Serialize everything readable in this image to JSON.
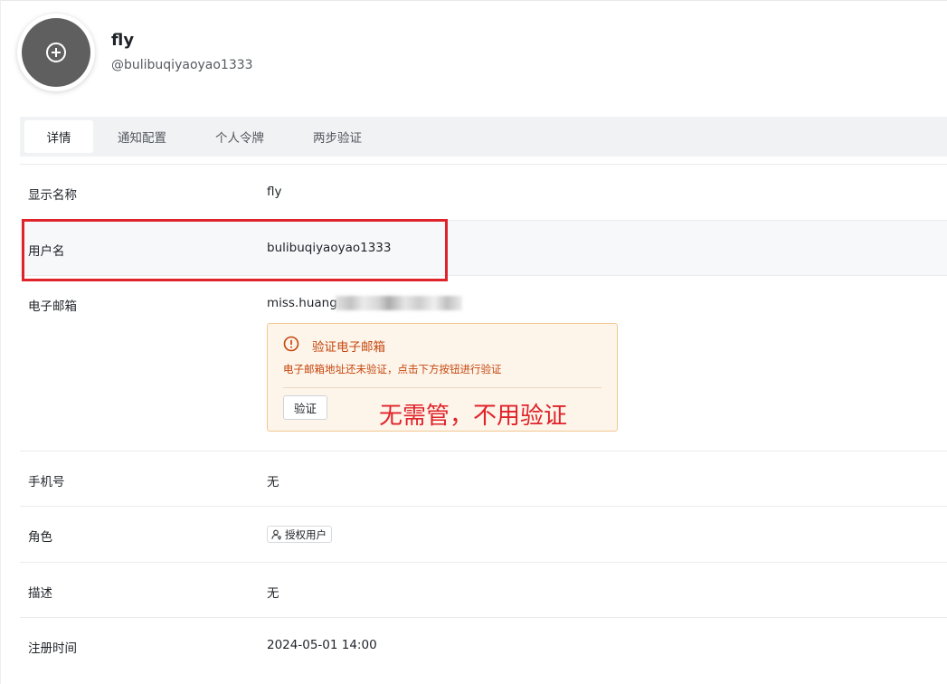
{
  "profile": {
    "display_name": "fly",
    "handle": "@bulibuqiyaoyao1333",
    "avatar_icon": "plus-circle-icon"
  },
  "tabs": [
    {
      "label": "详情",
      "active": true
    },
    {
      "label": "通知配置",
      "active": false
    },
    {
      "label": "个人令牌",
      "active": false
    },
    {
      "label": "两步验证",
      "active": false
    }
  ],
  "details": {
    "display_name_label": "显示名称",
    "display_name_value": "fly",
    "username_label": "用户名",
    "username_value": "bulibuqiyaoyao1333",
    "email_label": "电子邮箱",
    "email_value": "miss.huang",
    "phone_label": "手机号",
    "phone_value": "无",
    "role_label": "角色",
    "role_value": "授权用户",
    "role_icon": "user-key-icon",
    "description_label": "描述",
    "description_value": "无",
    "registered_label": "注册时间",
    "registered_value": "2024-05-01 14:00"
  },
  "email_alert": {
    "icon": "exclamation-circle-icon",
    "title": "验证电子邮箱",
    "description": "电子邮箱地址还未验证，点击下方按钮进行验证",
    "button_label": "验证"
  },
  "annotation": {
    "text": "无需管，不用验证",
    "color": "#e0232a"
  },
  "colors": {
    "alert_text": "#c5480f",
    "alert_bg": "#fdf4ea",
    "alert_border": "#f3c893",
    "avatar_bg": "#5f5f5f"
  }
}
